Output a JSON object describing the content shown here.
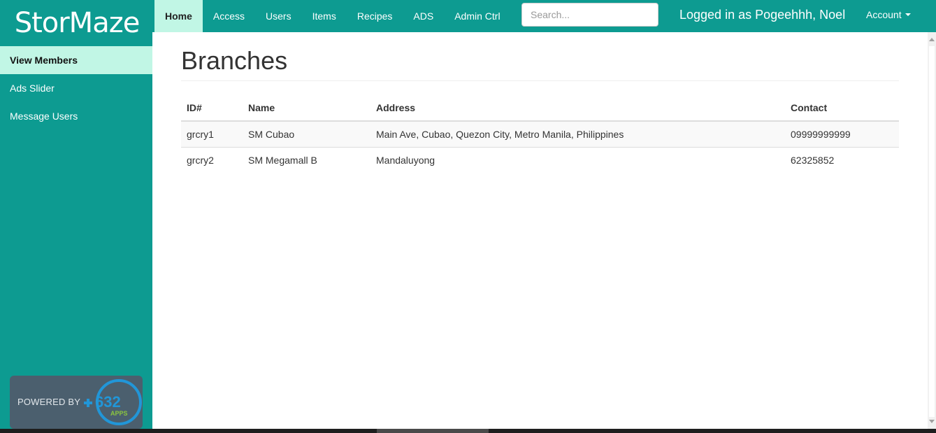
{
  "brand": {
    "name": "StorMaze"
  },
  "nav": {
    "items": [
      {
        "label": "Home",
        "active": true
      },
      {
        "label": "Access",
        "active": false
      },
      {
        "label": "Users",
        "active": false
      },
      {
        "label": "Items",
        "active": false
      },
      {
        "label": "Recipes",
        "active": false
      },
      {
        "label": "ADS",
        "active": false
      },
      {
        "label": "Admin Ctrl",
        "active": false
      }
    ],
    "search_placeholder": "Search...",
    "logged_in_text": "Logged in as Pogeehhh, Noel",
    "account_label": "Account"
  },
  "sidebar": {
    "items": [
      {
        "label": "View Members",
        "active": true
      },
      {
        "label": "Ads Slider",
        "active": false
      },
      {
        "label": "Message Users",
        "active": false
      }
    ],
    "powered_by": "POWERED BY",
    "powered_logo": {
      "number": "632",
      "sub": "APPS"
    }
  },
  "main": {
    "title": "Branches",
    "table": {
      "columns": [
        "ID#",
        "Name",
        "Address",
        "Contact"
      ],
      "rows": [
        [
          "grcry1",
          "SM Cubao",
          "Main Ave, Cubao, Quezon City, Metro Manila, Philippines",
          "09999999999"
        ],
        [
          "grcry2",
          "SM Megamall B",
          "Mandaluyong",
          "62325852"
        ]
      ]
    }
  },
  "colors": {
    "primary": "#0d9b91",
    "active_bg": "#c1f6e5",
    "powered_bg": "#4b5f6e",
    "logo_blue": "#2196d8",
    "logo_green": "#8bc53f"
  }
}
